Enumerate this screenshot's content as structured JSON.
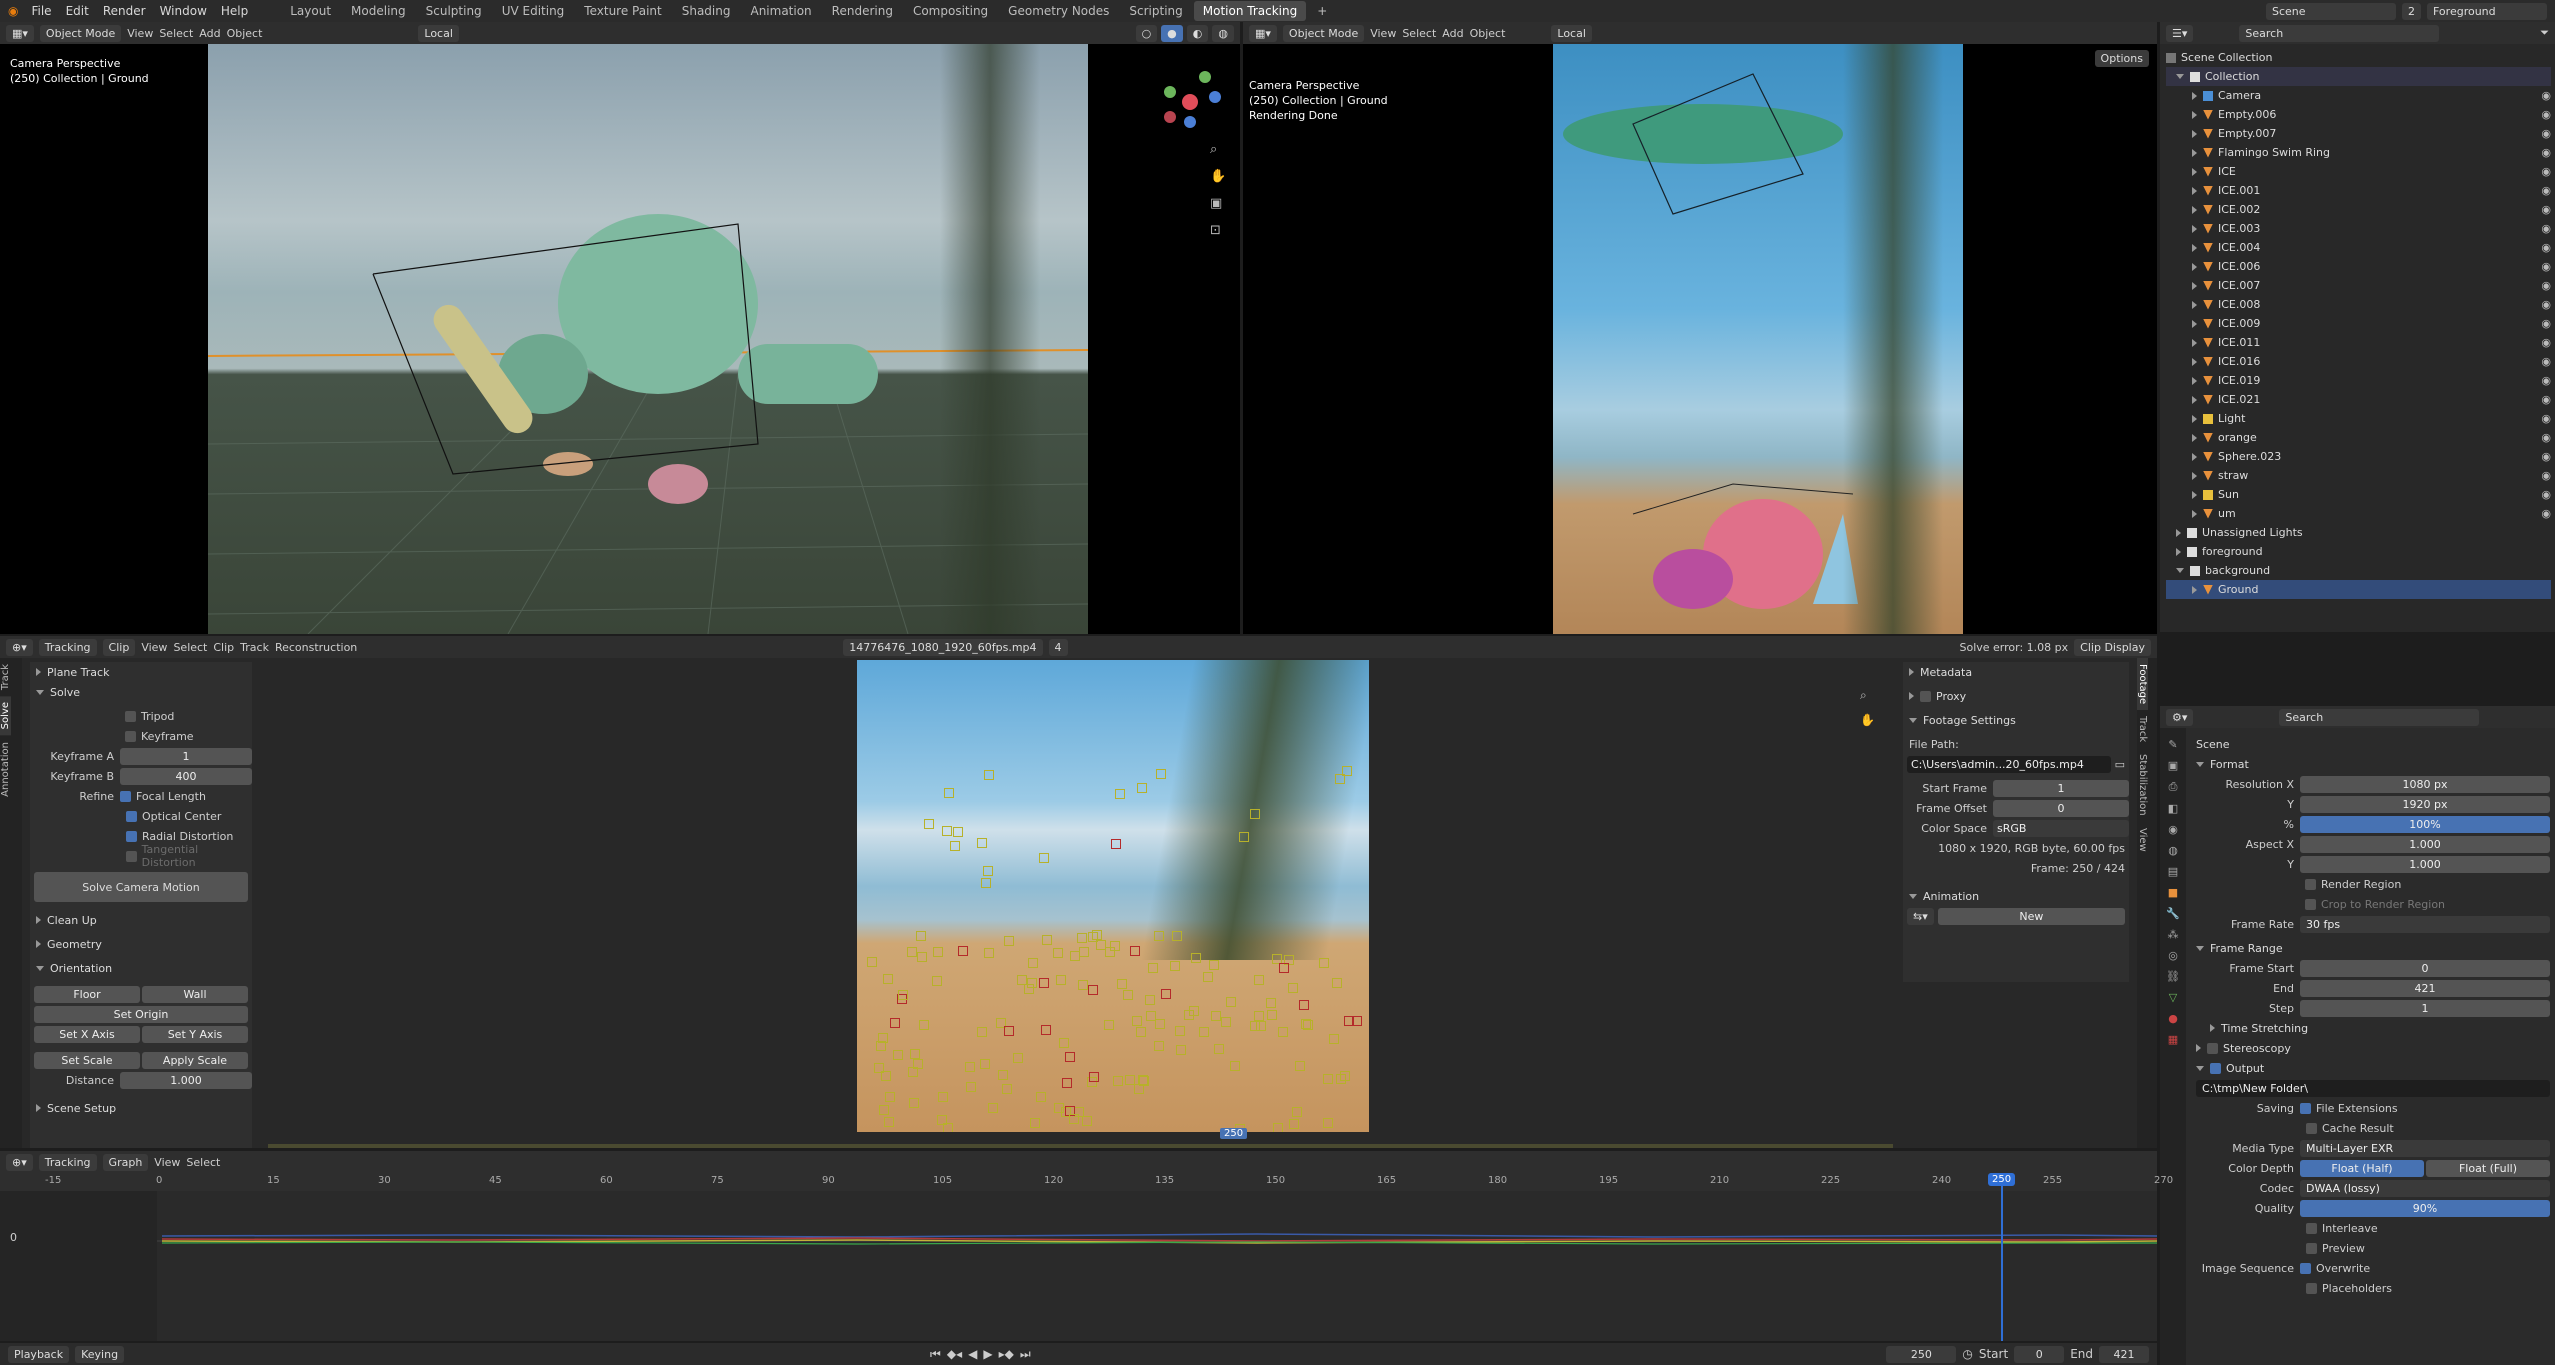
{
  "topbar": {
    "menus": [
      "File",
      "Edit",
      "Render",
      "Window",
      "Help"
    ],
    "workspaces": [
      "Layout",
      "Modeling",
      "Sculpting",
      "UV Editing",
      "Texture Paint",
      "Shading",
      "Animation",
      "Rendering",
      "Compositing",
      "Geometry Nodes",
      "Scripting",
      "Motion Tracking"
    ],
    "active_workspace": "Motion Tracking",
    "scene": "Scene",
    "scene_count": "2",
    "view_layer": "Foreground",
    "plus": "+"
  },
  "viewport_left": {
    "mode": "Object Mode",
    "menus": [
      "View",
      "Select",
      "Add",
      "Object"
    ],
    "orientation": "Local",
    "overlay": [
      "Camera Perspective",
      "(250) Collection | Ground"
    ]
  },
  "viewport_right": {
    "mode": "Object Mode",
    "menus": [
      "View",
      "Select",
      "Add",
      "Object"
    ],
    "orientation": "Local",
    "overlay": [
      "Camera Perspective",
      "(250) Collection | Ground",
      "Rendering Done"
    ],
    "options": "Options"
  },
  "outliner": {
    "search_placeholder": "Search",
    "root": "Scene Collection",
    "collection": "Collection",
    "items": [
      "Camera",
      "Empty.006",
      "Empty.007",
      "Flamingo Swim Ring",
      "ICE",
      "ICE.001",
      "ICE.002",
      "ICE.003",
      "ICE.004",
      "ICE.006",
      "ICE.007",
      "ICE.008",
      "ICE.009",
      "ICE.011",
      "ICE.016",
      "ICE.019",
      "ICE.021",
      "Light",
      "orange",
      "Sphere.023",
      "straw",
      "Sun",
      "um"
    ],
    "unassigned": "Unassigned Lights",
    "foreground": "foreground",
    "background": "background",
    "ground": "Ground"
  },
  "clip_editor": {
    "editor": "Tracking",
    "view": "Clip",
    "menus": [
      "View",
      "Select",
      "Clip",
      "Track",
      "Reconstruction"
    ],
    "clip_name": "14776476_1080_1920_60fps.mp4",
    "clip_users": "4",
    "solve_error": "Solve error: 1.08 px",
    "clip_display": "Clip Display",
    "frame_marker": "250"
  },
  "solve_panel": {
    "tabs": [
      "Track",
      "Solve",
      "Annotation"
    ],
    "plane_track": "Plane Track",
    "solve": "Solve",
    "tripod": "Tripod",
    "keyframe": "Keyframe",
    "keyframe_a_label": "Keyframe A",
    "keyframe_a": "1",
    "keyframe_b_label": "Keyframe B",
    "keyframe_b": "400",
    "refine_label": "Refine",
    "focal_length": "Focal Length",
    "optical_center": "Optical Center",
    "radial_distortion": "Radial Distortion",
    "tangential": "Tangential Distortion",
    "solve_button": "Solve Camera Motion",
    "clean_up": "Clean Up",
    "geometry": "Geometry",
    "orientation": "Orientation",
    "floor": "Floor",
    "wall": "Wall",
    "set_origin": "Set Origin",
    "set_x": "Set X Axis",
    "set_y": "Set Y Axis",
    "set_scale": "Set Scale",
    "apply_scale": "Apply Scale",
    "distance_label": "Distance",
    "distance": "1.000",
    "scene_setup": "Scene Setup"
  },
  "footage_panel": {
    "tabs": [
      "Footage",
      "Track",
      "Stabilization",
      "View"
    ],
    "metadata": "Metadata",
    "proxy": "Proxy",
    "footage_settings": "Footage Settings",
    "file_path_label": "File Path:",
    "file_path": "C:\\Users\\admin...20_60fps.mp4",
    "start_frame_label": "Start Frame",
    "start_frame": "1",
    "frame_offset_label": "Frame Offset",
    "frame_offset": "0",
    "color_space_label": "Color Space",
    "color_space": "sRGB",
    "info": "1080 x 1920, RGB byte, 60.00 fps",
    "frame_info": "Frame: 250 / 424",
    "animation": "Animation",
    "new": "New"
  },
  "graph_editor": {
    "editor": "Tracking",
    "view": "Graph",
    "menus": [
      "View",
      "Select"
    ],
    "ticks": [
      "-15",
      "0",
      "15",
      "30",
      "45",
      "60",
      "75",
      "90",
      "105",
      "120",
      "135",
      "150",
      "165",
      "180",
      "195",
      "210",
      "225",
      "240",
      "255",
      "270"
    ],
    "current": "250",
    "zero": "0"
  },
  "timeline": {
    "playback": "Playback",
    "keying": "Keying",
    "current_frame": "250",
    "start_label": "Start",
    "start": "0",
    "end_label": "End",
    "end": "421"
  },
  "properties": {
    "search_placeholder": "Search",
    "scene": "Scene",
    "format": "Format",
    "res_x_label": "Resolution X",
    "res_x": "1080 px",
    "res_y_label": "Y",
    "res_y": "1920 px",
    "pct_label": "%",
    "pct": "100%",
    "aspect_x_label": "Aspect X",
    "aspect_x": "1.000",
    "aspect_y_label": "Y",
    "aspect_y": "1.000",
    "render_region": "Render Region",
    "crop": "Crop to Render Region",
    "frame_rate_label": "Frame Rate",
    "frame_rate": "30 fps",
    "frame_range": "Frame Range",
    "frame_start_label": "Frame Start",
    "frame_start": "0",
    "end_label": "End",
    "end": "421",
    "step_label": "Step",
    "step": "1",
    "time_stretching": "Time Stretching",
    "stereoscopy": "Stereoscopy",
    "output": "Output",
    "output_path": "C:\\tmp\\New Folder\\",
    "saving_label": "Saving",
    "file_ext": "File Extensions",
    "cache_result": "Cache Result",
    "media_type_label": "Media Type",
    "media_type": "Multi-Layer EXR",
    "color_depth_label": "Color Depth",
    "depth_half": "Float (Half)",
    "depth_full": "Float (Full)",
    "codec_label": "Codec",
    "codec": "DWAA (lossy)",
    "quality_label": "Quality",
    "quality": "90%",
    "interleave": "Interleave",
    "preview": "Preview",
    "image_seq_label": "Image Sequence",
    "overwrite": "Overwrite",
    "placeholders": "Placeholders"
  },
  "colors": {
    "accent": "#4772b3",
    "active_ws": "#4a4a4a",
    "frame_line": "#2f6fd6"
  }
}
